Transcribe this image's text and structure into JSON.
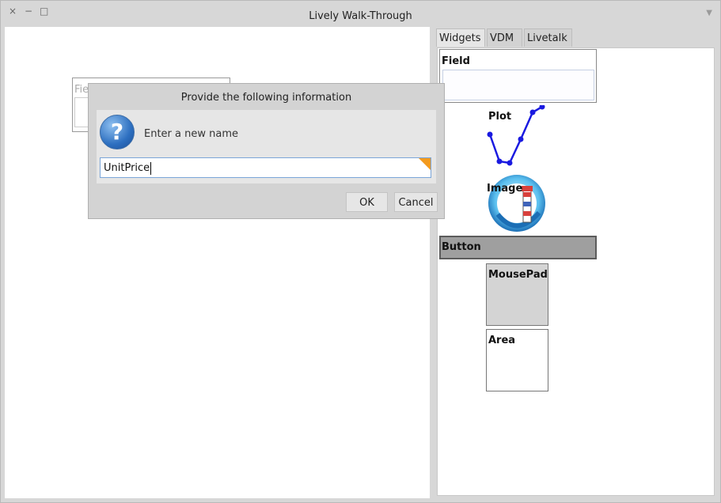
{
  "window": {
    "title": "Lively Walk-Through",
    "controls": {
      "close": "×",
      "minimize": "−",
      "maximize": "□"
    }
  },
  "canvas": {
    "background_field": {
      "label": "Fie"
    }
  },
  "dialog": {
    "title": "Provide the following information",
    "prompt": "Enter a new name",
    "input_value": "UnitPrice",
    "ok_label": "OK",
    "cancel_label": "Cancel",
    "icon": "question-icon"
  },
  "palette": {
    "tabs": [
      {
        "label": "Widgets",
        "active": true
      },
      {
        "label": "VDM",
        "active": false
      },
      {
        "label": "Livetalk",
        "active": false
      }
    ],
    "widgets": {
      "field": "Field",
      "plot": "Plot",
      "image": "Image",
      "button": "Button",
      "mousepad": "MousePad",
      "area": "Area"
    },
    "plot_series": [
      2,
      0.2,
      0.0,
      2.0,
      4.6,
      5.2
    ]
  },
  "colors": {
    "accent_orange": "#f39a1e",
    "plot_blue": "#1a1ae0",
    "selection_blue": "#7aa5d8"
  }
}
